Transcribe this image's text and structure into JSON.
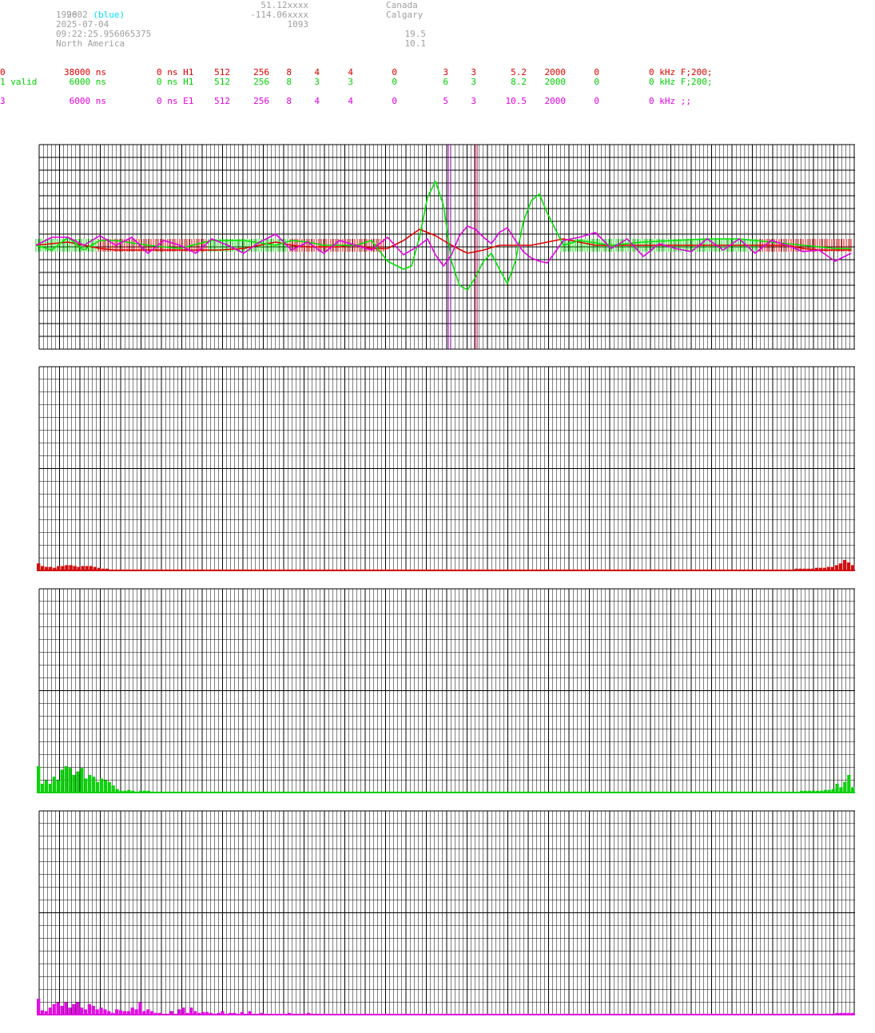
{
  "header": {
    "station_id": "2602",
    "station_tag": "(blue)",
    "line2": "1990",
    "date": "2025-07-04",
    "time": "09:22:25.956065375",
    "region": "North America",
    "lat": "51.12xxxx",
    "lon": "-114.06xxxx",
    "alt": "1093",
    "country": "Canada",
    "city": "Calgary",
    "val1": "19.5",
    "val2": "10.1"
  },
  "channels": [
    {
      "color": "#e00000",
      "c0": "0",
      "c1": "38000 ns",
      "c2": "0 ns H1",
      "c3": "512",
      "c4": "256",
      "c5": "8",
      "c6": "4",
      "c7": "4",
      "c8": "0",
      "c9": "3",
      "c10": "3",
      "c11": "5.2",
      "c12": "2000",
      "c13": "0",
      "c14": "0 kHz F;200;"
    },
    {
      "color": "#00d000",
      "c0": "1 valid",
      "c1": "6000 ns",
      "c2": "0 ns H1",
      "c3": "512",
      "c4": "256",
      "c5": "8",
      "c6": "3",
      "c7": "3",
      "c8": "0",
      "c9": "6",
      "c10": "3",
      "c11": "8.2",
      "c12": "2000",
      "c13": "0",
      "c14": "0 kHz F;200;"
    },
    {
      "color": "#e000e0",
      "c0": "3",
      "c1": "6000 ns",
      "c2": "0 ns E1",
      "c3": "512",
      "c4": "256",
      "c5": "8",
      "c6": "4",
      "c7": "4",
      "c8": "0",
      "c9": "5",
      "c10": "3",
      "c11": "10.5",
      "c12": "2000",
      "c13": "0",
      "c14": "0 kHz ;;"
    }
  ],
  "chart_data": [
    {
      "type": "line",
      "series": [
        {
          "color": "#e00000",
          "x": [
            0,
            40,
            60,
            80,
            100,
            130,
            160,
            200,
            230,
            260,
            280,
            300,
            320,
            340,
            360,
            380,
            390,
            400,
            420,
            440,
            460,
            480,
            500,
            520,
            540,
            560,
            580,
            620,
            660,
            700,
            740,
            780,
            820,
            860,
            900,
            940,
            960,
            980,
            1000,
            1020
          ],
          "y": [
            0,
            0.2,
            0,
            -0.2,
            -0.3,
            -0.3,
            -0.3,
            -0.3,
            -0.3,
            -0.2,
            0,
            0.2,
            0,
            -0.1,
            -0.1,
            -0.1,
            0,
            0,
            -0.2,
            -0.2,
            0.3,
            1.0,
            0.6,
            0,
            -0.5,
            -0.3,
            0,
            0,
            0.4,
            0,
            0,
            0,
            0,
            0,
            0,
            0,
            -0.2,
            -0.3,
            -0.3,
            -0.3
          ]
        },
        {
          "color": "#00e000",
          "x": [
            0,
            20,
            40,
            60,
            80,
            100,
            140,
            180,
            220,
            260,
            300,
            320,
            340,
            360,
            380,
            400,
            420,
            440,
            460,
            470,
            480,
            490,
            500,
            510,
            520,
            530,
            540,
            550,
            560,
            570,
            580,
            590,
            600,
            610,
            620,
            630,
            640,
            660,
            680,
            720,
            760,
            800,
            840,
            880,
            920,
            960,
            1000,
            1020
          ],
          "y": [
            0,
            -0.3,
            0.5,
            -0.3,
            0.3,
            0.3,
            0,
            -0.2,
            0.3,
            0.3,
            0,
            0.3,
            0.2,
            0,
            0,
            0,
            0.3,
            -1.0,
            -1.5,
            -1.3,
            0.5,
            3.0,
            4.0,
            2.5,
            -1.0,
            -2.5,
            -2.8,
            -2.0,
            -1.0,
            -0.5,
            -1.5,
            -2.4,
            -1.0,
            1.5,
            2.8,
            3.2,
            2.0,
            0,
            0.3,
            0,
            0.2,
            0.3,
            0.4,
            0.4,
            0.2,
            0,
            -0.2,
            -0.2
          ]
        },
        {
          "color": "#e000e0",
          "x": [
            0,
            20,
            40,
            60,
            80,
            100,
            120,
            140,
            160,
            180,
            200,
            220,
            240,
            260,
            280,
            300,
            320,
            340,
            360,
            380,
            400,
            420,
            440,
            460,
            480,
            490,
            500,
            510,
            520,
            530,
            540,
            550,
            560,
            570,
            580,
            590,
            600,
            610,
            620,
            630,
            640,
            660,
            680,
            700,
            720,
            740,
            760,
            780,
            800,
            820,
            840,
            860,
            880,
            900,
            920,
            940,
            960,
            980,
            1000,
            1020
          ],
          "y": [
            0,
            0.5,
            0.5,
            0,
            0.6,
            0,
            0.5,
            -0.5,
            0.3,
            0,
            -0.5,
            0.4,
            0,
            -0.5,
            0.2,
            0.7,
            -0.3,
            0.2,
            -0.5,
            0.3,
            0,
            -0.3,
            0.5,
            -0.6,
            0,
            0.4,
            -0.6,
            -1.3,
            -0.6,
            0.6,
            1.2,
            1.0,
            0.5,
            0.1,
            0.8,
            1.1,
            0.3,
            -0.4,
            -0.8,
            -1.0,
            -1.1,
            0.3,
            0.5,
            0.8,
            -0.2,
            0.4,
            -0.7,
            0.1,
            -0.2,
            -0.4,
            0.4,
            -0.3,
            0.4,
            -0.5,
            0.3,
            0,
            -0.4,
            -0.3,
            -1.0,
            -0.5
          ]
        }
      ]
    },
    {
      "type": "bar",
      "color": "#d01010",
      "values": [
        8,
        5,
        4,
        4,
        3,
        5,
        5,
        6,
        6,
        5,
        4,
        5,
        5,
        5,
        4,
        3,
        2,
        2,
        1,
        1,
        1,
        1,
        1,
        1,
        1,
        1,
        1,
        1,
        1,
        1,
        1,
        1,
        1,
        1,
        1,
        1,
        1,
        1,
        1,
        1,
        1,
        1,
        1,
        1,
        1,
        1,
        1,
        1,
        1,
        1,
        1,
        1,
        1,
        1,
        1,
        1,
        1,
        1,
        1,
        1,
        1,
        1,
        1,
        1,
        1,
        1,
        1,
        1,
        1,
        1,
        1,
        1,
        1,
        1,
        1,
        1,
        1,
        1,
        1,
        1,
        1,
        1,
        1,
        1,
        1,
        1,
        1,
        1,
        1,
        1,
        1,
        1,
        1,
        1,
        1,
        1,
        1,
        1,
        1,
        1,
        1,
        1,
        1,
        1,
        1,
        1,
        1,
        1,
        1,
        1,
        1,
        1,
        1,
        1,
        1,
        1,
        1,
        1,
        1,
        1,
        1,
        1,
        1,
        1,
        1,
        1,
        1,
        1,
        1,
        1,
        1,
        1,
        1,
        1,
        1,
        1,
        1,
        1,
        1,
        1,
        1,
        1,
        1,
        1,
        1,
        1,
        1,
        1,
        1,
        1,
        1,
        1,
        1,
        1,
        1,
        1,
        1,
        1,
        1,
        1,
        1,
        1,
        1,
        1,
        1,
        1,
        1,
        1,
        1,
        1,
        1,
        1,
        1,
        1,
        1,
        1,
        1,
        1,
        1,
        1,
        1,
        1,
        1,
        1,
        1,
        1,
        1,
        1,
        2,
        2,
        2,
        2,
        2,
        3,
        3,
        3,
        4,
        4,
        6,
        8,
        12,
        9,
        6
      ]
    },
    {
      "type": "bar",
      "color": "#10d010",
      "values": [
        30,
        10,
        14,
        10,
        18,
        14,
        26,
        30,
        28,
        20,
        24,
        28,
        16,
        20,
        18,
        12,
        16,
        14,
        12,
        8,
        4,
        2,
        2,
        3,
        2,
        1,
        2,
        2,
        2,
        1,
        1,
        1,
        1,
        1,
        1,
        1,
        1,
        1,
        1,
        1,
        1,
        1,
        1,
        1,
        1,
        1,
        1,
        1,
        1,
        1,
        1,
        1,
        1,
        1,
        1,
        1,
        1,
        1,
        1,
        1,
        1,
        1,
        1,
        1,
        1,
        1,
        1,
        1,
        1,
        1,
        1,
        1,
        1,
        1,
        1,
        1,
        1,
        1,
        1,
        1,
        1,
        1,
        1,
        1,
        1,
        1,
        1,
        1,
        1,
        1,
        1,
        1,
        1,
        1,
        1,
        1,
        1,
        1,
        1,
        1,
        1,
        1,
        1,
        1,
        1,
        1,
        1,
        1,
        1,
        1,
        1,
        1,
        1,
        1,
        1,
        1,
        1,
        1,
        1,
        1,
        1,
        1,
        1,
        1,
        1,
        1,
        1,
        1,
        1,
        1,
        1,
        1,
        1,
        1,
        1,
        1,
        1,
        1,
        1,
        1,
        1,
        1,
        1,
        1,
        1,
        1,
        1,
        1,
        1,
        1,
        1,
        1,
        1,
        1,
        1,
        1,
        1,
        1,
        1,
        1,
        1,
        1,
        1,
        1,
        1,
        1,
        1,
        1,
        1,
        1,
        1,
        1,
        1,
        1,
        1,
        1,
        1,
        1,
        1,
        1,
        1,
        1,
        1,
        1,
        1,
        1,
        1,
        1,
        1,
        1,
        1,
        1,
        1,
        1,
        2,
        2,
        2,
        2,
        2,
        2,
        3,
        3,
        4,
        10,
        6,
        12,
        20,
        6
      ]
    },
    {
      "type": "bar",
      "color": "#e010e0",
      "values": [
        18,
        5,
        4,
        8,
        12,
        14,
        10,
        14,
        8,
        12,
        14,
        8,
        6,
        12,
        10,
        6,
        8,
        6,
        4,
        2,
        6,
        5,
        4,
        4,
        8,
        6,
        14,
        4,
        6,
        4,
        2,
        2,
        1,
        1,
        4,
        1,
        6,
        8,
        2,
        8,
        4,
        2,
        3,
        3,
        2,
        1,
        2,
        4,
        1,
        2,
        2,
        1,
        3,
        1,
        4,
        1,
        1,
        2,
        1,
        1,
        1,
        1,
        1,
        1,
        2,
        1,
        1,
        1,
        1,
        2,
        1,
        1,
        1,
        1,
        1,
        1,
        1,
        1,
        1,
        1,
        1,
        1,
        1,
        1,
        1,
        1,
        1,
        1,
        1,
        1,
        1,
        1,
        1,
        1,
        1,
        1,
        1,
        1,
        1,
        1,
        1,
        1,
        1,
        1,
        1,
        1,
        1,
        1,
        1,
        1,
        1,
        1,
        1,
        1,
        1,
        1,
        1,
        1,
        1,
        1,
        1,
        1,
        1,
        1,
        1,
        1,
        1,
        1,
        1,
        1,
        1,
        1,
        1,
        1,
        1,
        1,
        1,
        1,
        1,
        1,
        1,
        1,
        1,
        1,
        1,
        1,
        1,
        1,
        1,
        1,
        1,
        1,
        1,
        1,
        1,
        1,
        1,
        1,
        1,
        1,
        1,
        1,
        1,
        1,
        1,
        1,
        1,
        1,
        1,
        1,
        1,
        1,
        1,
        1,
        1,
        1,
        1,
        1,
        1,
        1,
        1,
        1,
        1,
        1,
        1,
        1,
        1,
        1,
        1,
        1,
        1,
        1,
        1,
        1,
        1,
        1,
        1,
        1,
        1,
        1,
        1,
        1,
        1,
        1,
        2,
        2,
        2,
        2,
        2
      ]
    }
  ]
}
